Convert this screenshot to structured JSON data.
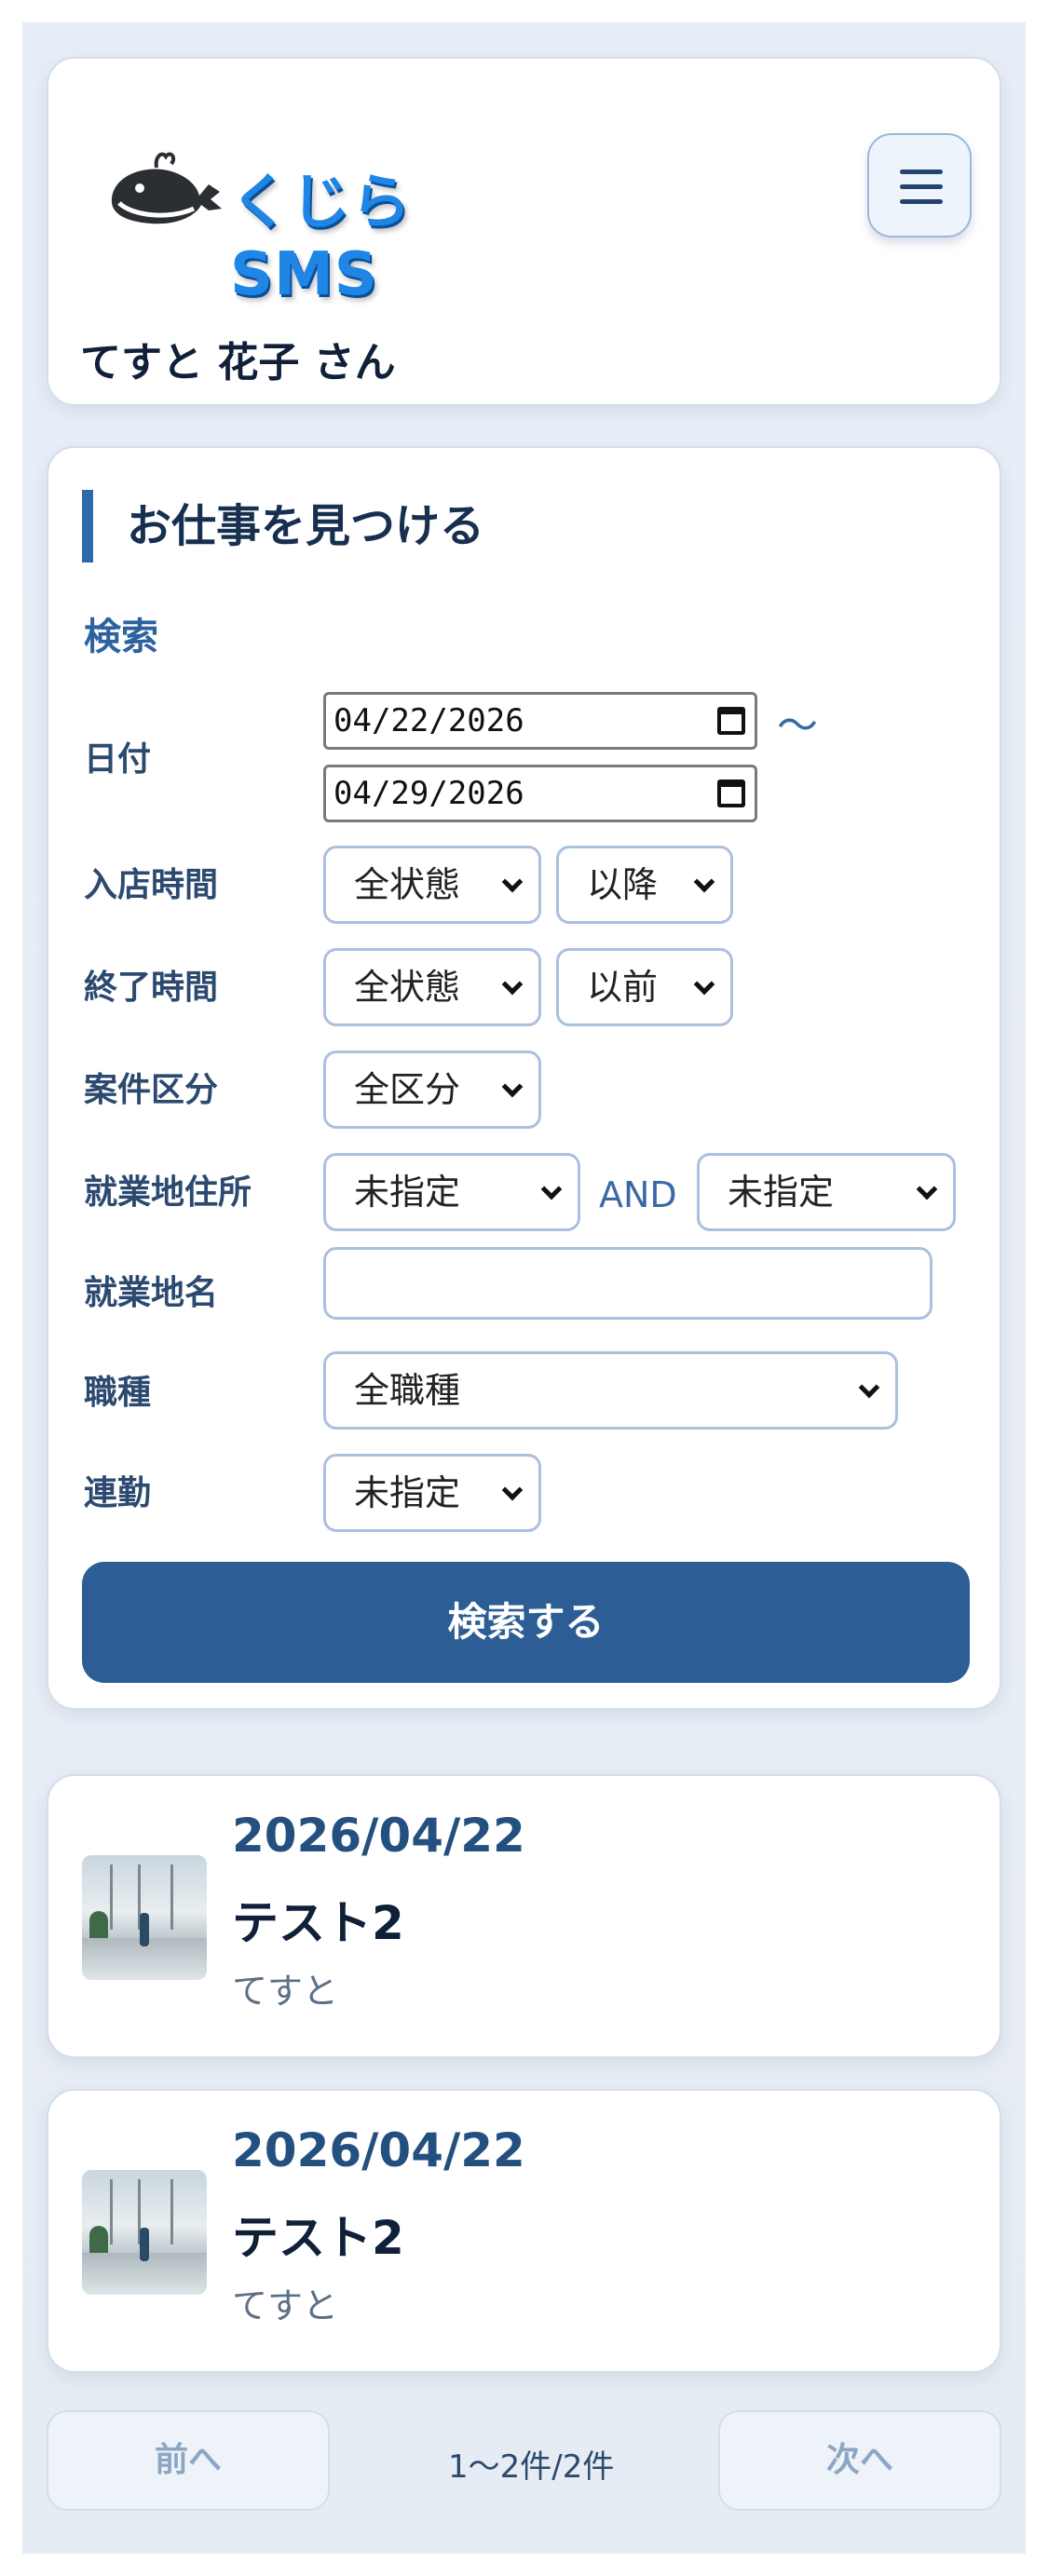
{
  "header": {
    "logo_text": "くじらSMS",
    "user_name": "てすと 花子 さん"
  },
  "search": {
    "section_title": "お仕事を見つける",
    "subtitle": "検索",
    "labels": {
      "date": "日付",
      "start_time": "入店時間",
      "end_time": "終了時間",
      "category": "案件区分",
      "address": "就業地住所",
      "place_name": "就業地名",
      "job_type": "職種",
      "consecutive": "連勤"
    },
    "date_from": "04/22/2026",
    "date_to": "04/29/2026",
    "tilde": "〜",
    "start_time_value": "全状態",
    "start_time_mod": "以降",
    "end_time_value": "全状態",
    "end_time_mod": "以前",
    "category_value": "全区分",
    "address_1": "未指定",
    "address_and": "AND",
    "address_2": "未指定",
    "place_name_value": "",
    "job_type_value": "全職種",
    "consecutive_value": "未指定",
    "submit_label": "検索する"
  },
  "results": [
    {
      "date": "2026/04/22",
      "title": "テスト2",
      "sub": "てすと"
    },
    {
      "date": "2026/04/22",
      "title": "テスト2",
      "sub": "てすと"
    }
  ],
  "pager": {
    "prev_label": "前へ",
    "info": "1〜2件/2件",
    "next_label": "次へ"
  },
  "icons": {
    "menu": "hamburger-icon",
    "logo": "whale-icon",
    "calendar": "calendar-icon"
  }
}
